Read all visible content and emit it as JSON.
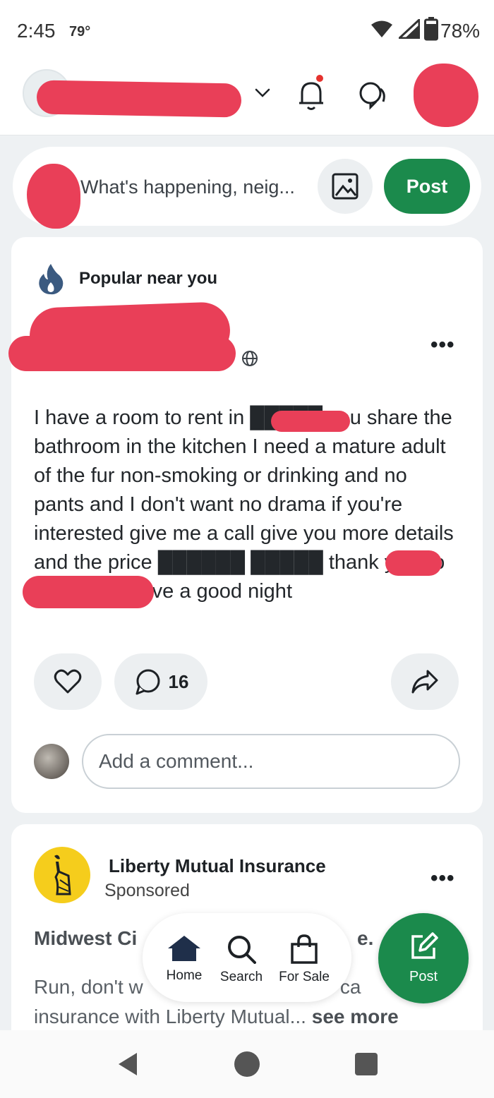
{
  "status_bar": {
    "time": "2:45",
    "temperature": "79°",
    "battery": "78%"
  },
  "header": {
    "notification_badge": true
  },
  "compose": {
    "placeholder": "What's happening, neig...",
    "post_label": "Post"
  },
  "post": {
    "tag": "Popular near you",
    "body": "I have a room to rent in █████ you share the bathroom in the kitchen I need a mature adult of the fur non-smoking or drinking and no pants and I don't want no drama if you're interested give me a call give you more details and the price ██████ █████ thank you so much and have a good night",
    "comment_count": "16",
    "comment_placeholder": "Add a comment..."
  },
  "ad": {
    "sponsor": "Liberty Mutual Insurance",
    "sponsored_label": "Sponsored",
    "headline": "Midwest Ci",
    "headline_end": "e.",
    "body_start": "Run, don't w",
    "body_mid": "r ca",
    "body_line2": "insurance with Liberty Mutual...",
    "see_more": "see more"
  },
  "bottom_nav": {
    "items": [
      {
        "label": "Home"
      },
      {
        "label": "Search"
      },
      {
        "label": "For Sale"
      }
    ],
    "fab_label": "Post"
  },
  "colors": {
    "brand_green": "#1b8a4c",
    "redaction": "#e93f58",
    "notification": "#e5322e",
    "flame": "#3b5a80"
  }
}
